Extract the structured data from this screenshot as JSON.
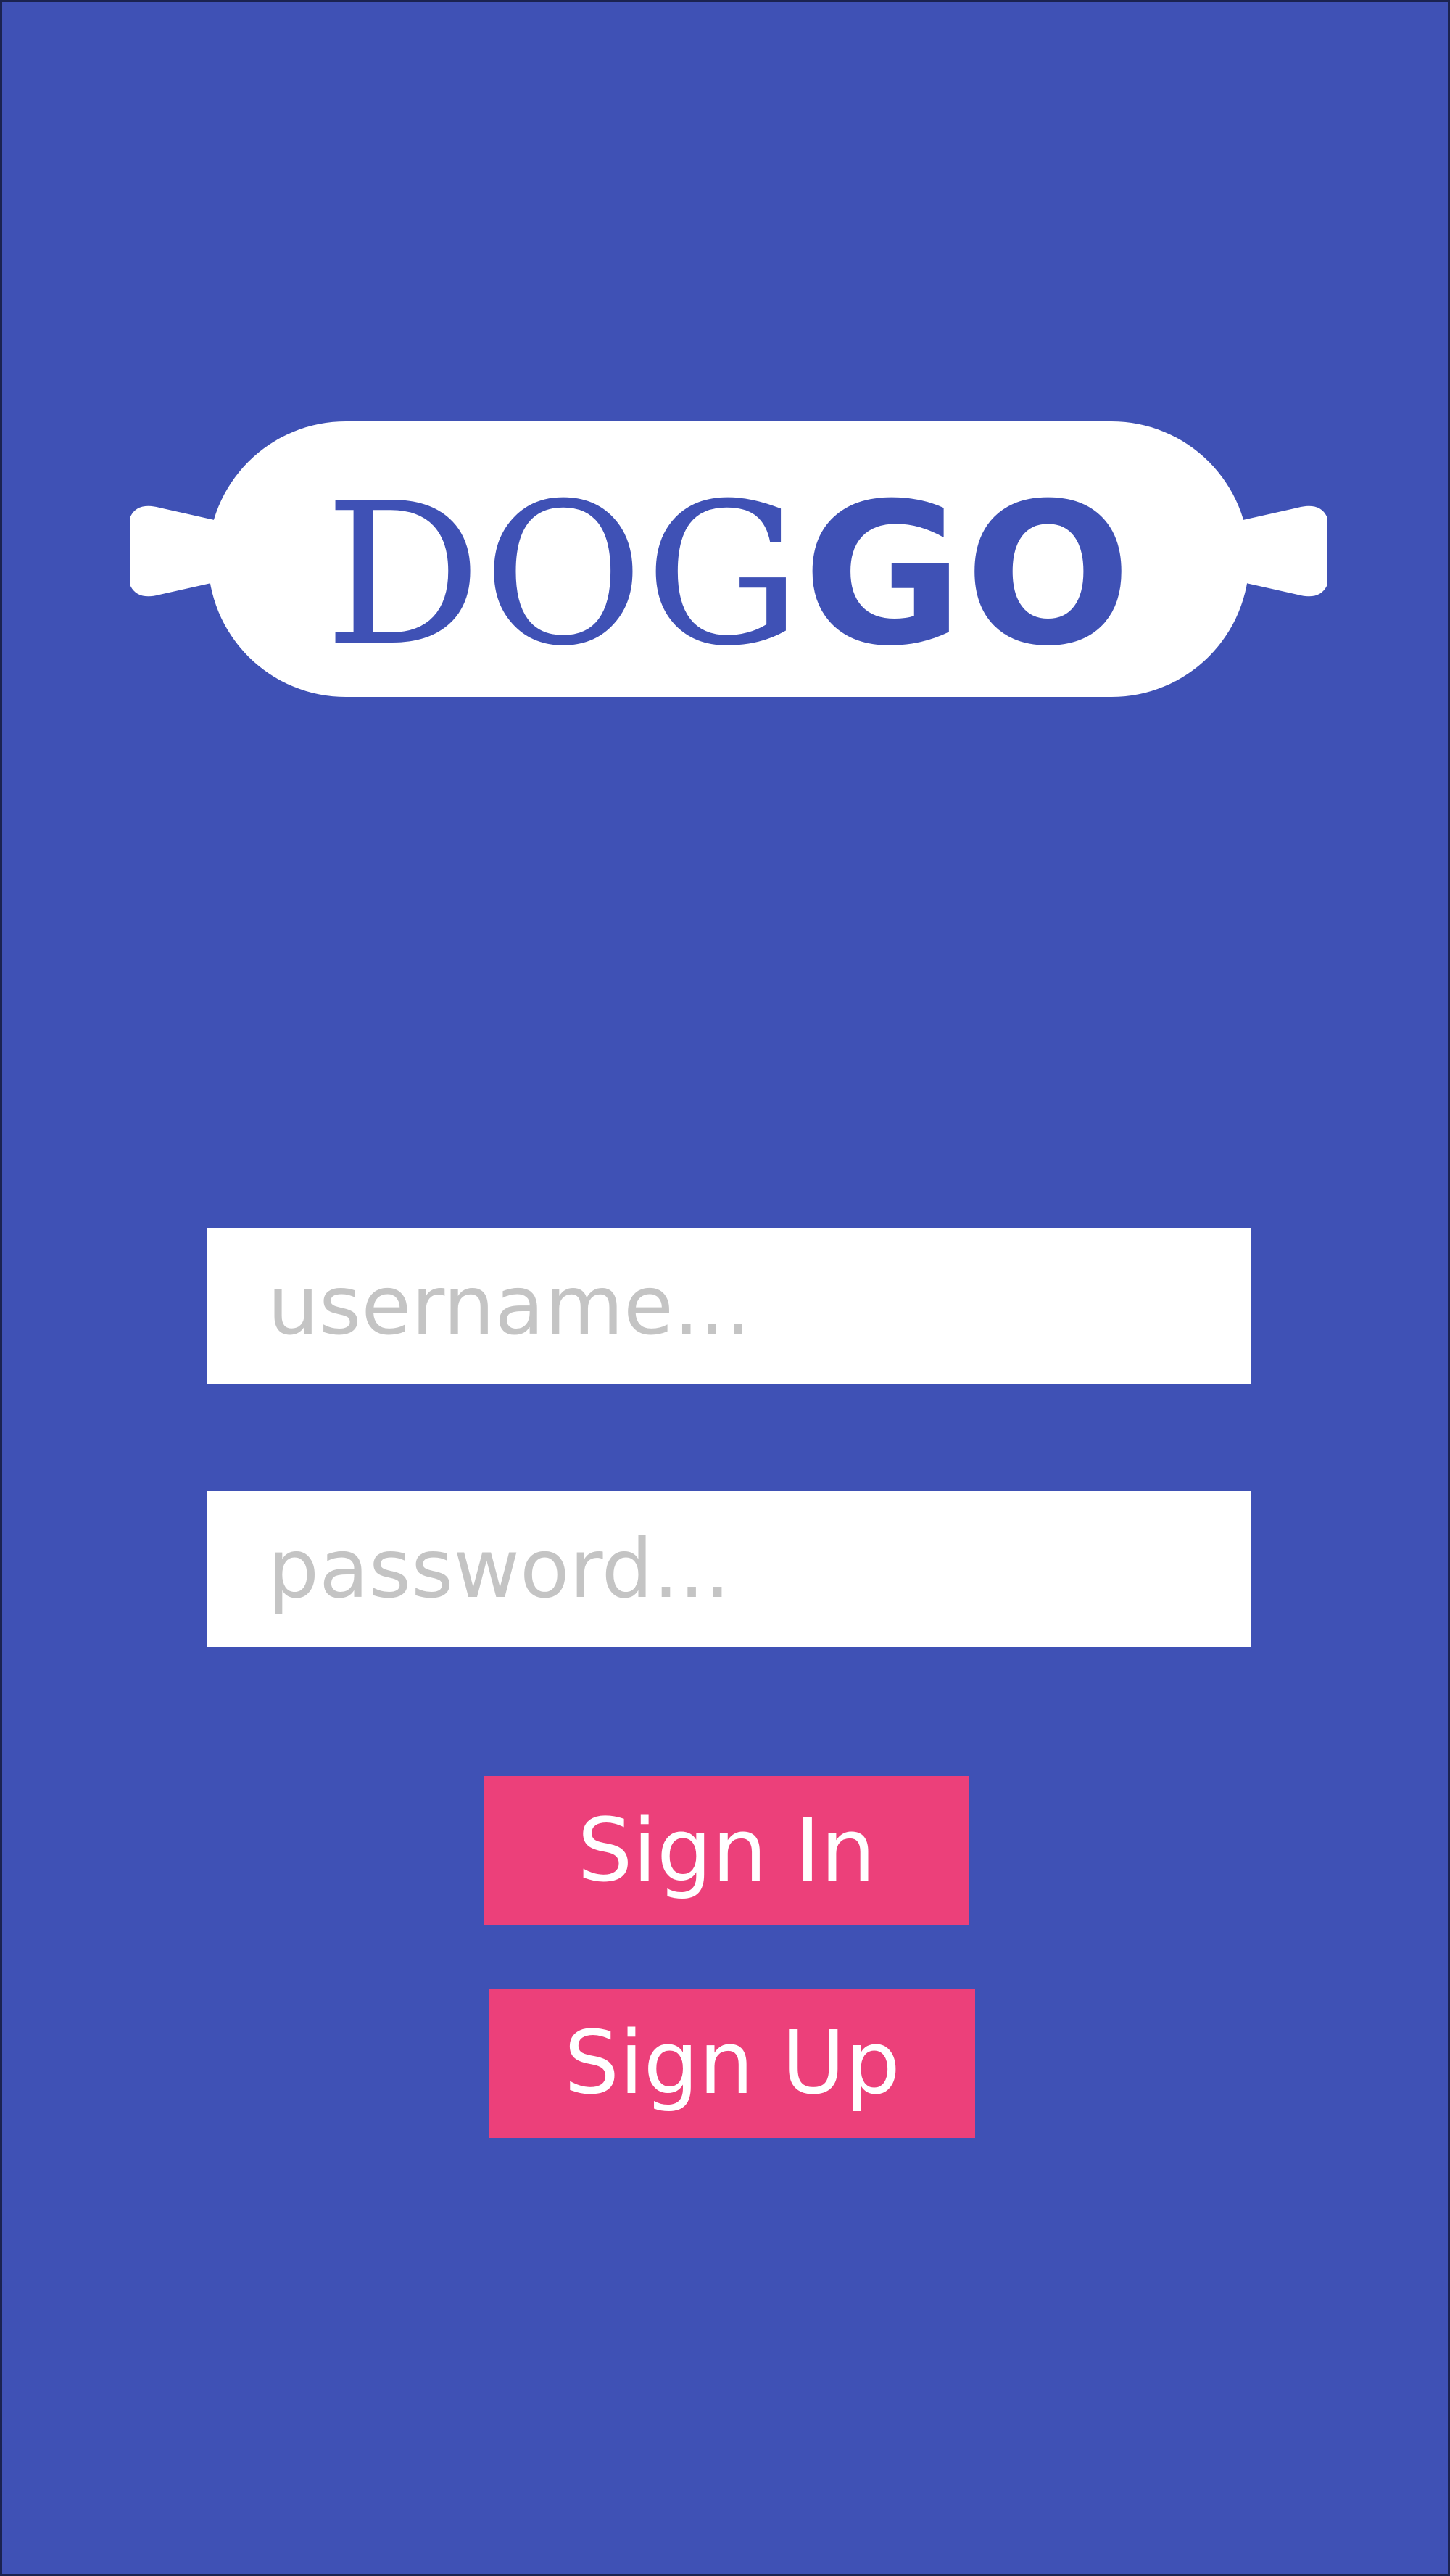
{
  "app": {
    "logo": {
      "light_text": "DOG",
      "bold_text": "GO",
      "shape_icon": "hotdog-bone-icon",
      "text_color": "#3f51b5",
      "fill_color": "#ffffff"
    }
  },
  "login_form": {
    "username": {
      "value": "",
      "placeholder": "username..."
    },
    "password": {
      "value": "",
      "placeholder": "password..."
    },
    "sign_in_label": "Sign In",
    "sign_up_label": "Sign Up"
  },
  "colors": {
    "background": "#3f51b5",
    "button": "#ec407a",
    "field_background": "#ffffff",
    "placeholder": "#c4c4c4"
  }
}
